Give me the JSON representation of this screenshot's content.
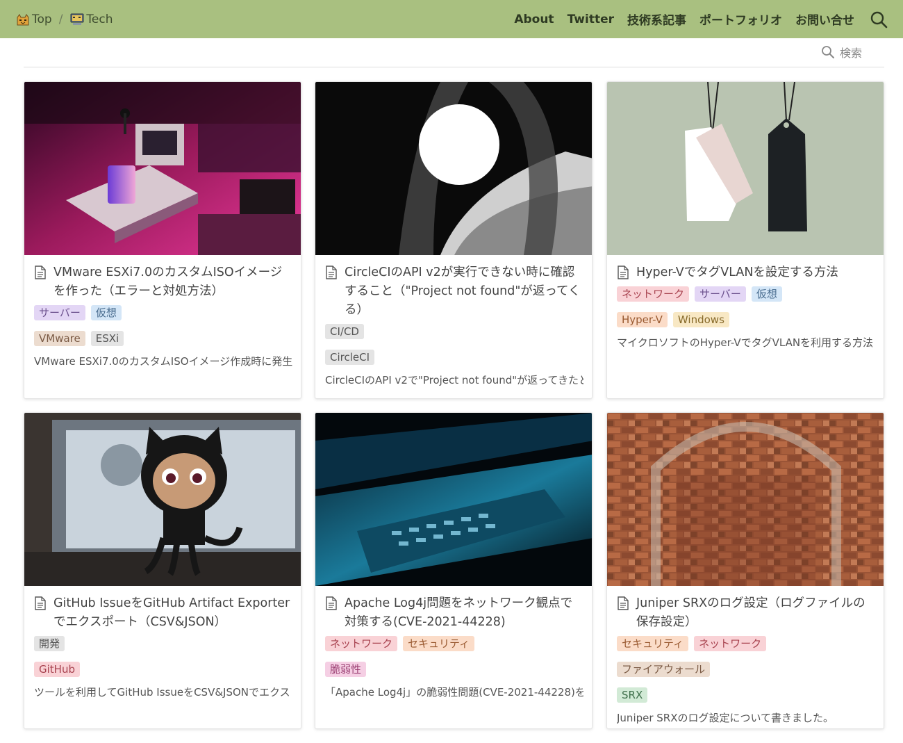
{
  "nav": {
    "crumbs": [
      {
        "label": "Top",
        "icon": "cat-icon"
      },
      {
        "label": "Tech",
        "icon": "computer-icon"
      }
    ],
    "separator": "/",
    "links": [
      "About",
      "Twitter",
      "技術系記事",
      "ポートフォリオ",
      "お問い合せ"
    ],
    "search_icon": "search-icon",
    "bg_color": "#a9c080"
  },
  "search": {
    "label": "検索"
  },
  "cards": [
    {
      "title": "VMware ESXi7.0のカスタムISOイメージを作った（エラーと対処方法）",
      "tags": [
        [
          "サーバー",
          "仮想"
        ],
        [
          "VMware",
          "ESXi"
        ]
      ],
      "excerpt": "VMware ESXi7.0のカスタムISOイメージ作成時に発生"
    },
    {
      "title": "CircleCIのAPI v2が実行できない時に確認すること（\"Project not found\"が返ってくる）",
      "tags": [
        [
          "CI/CD"
        ],
        [
          "CircleCI"
        ]
      ],
      "excerpt": "CircleCIのAPI v2で\"Project not found\"が返ってきたと"
    },
    {
      "title": "Hyper-VでタグVLANを設定する方法",
      "tags": [
        [
          "ネットワーク",
          "サーバー",
          "仮想"
        ],
        [
          "Hyper-V",
          "Windows"
        ]
      ],
      "excerpt": "マイクロソフトのHyper-VでタグVLANを利用する方法"
    },
    {
      "title": "GitHub IssueをGitHub Artifact Exporterでエクスポート（CSV&JSON）",
      "tags": [
        [
          "開発"
        ],
        [
          "GitHub"
        ]
      ],
      "excerpt": "ツールを利用してGitHub IssueをCSV&JSONでエクス"
    },
    {
      "title": "Apache Log4j問題をネットワーク観点で対策する(CVE-2021-44228)",
      "tags": [
        [
          "ネットワーク",
          "セキュリティ"
        ],
        [
          "脆弱性"
        ]
      ],
      "excerpt": "「Apache Log4j」の脆弱性問題(CVE-2021-44228)を"
    },
    {
      "title": "Juniper SRXのログ設定（ログファイルの保存設定）",
      "tags": [
        [
          "セキュリティ",
          "ネットワーク"
        ],
        [
          "ファイアウォール"
        ],
        [
          "SRX"
        ]
      ],
      "excerpt": "Juniper SRXのログ設定について書きました。"
    }
  ]
}
